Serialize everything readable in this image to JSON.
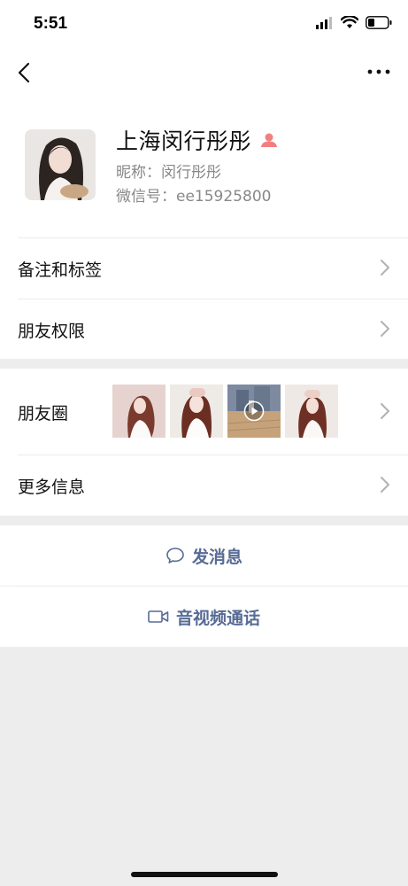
{
  "status_bar": {
    "time": "5:51"
  },
  "profile": {
    "name": "上海闵行彤彤",
    "nickname_line": "昵称：闵行彤彤",
    "wechat_id_line": "微信号：ee15925800"
  },
  "menu": {
    "remarks_tags": "备注和标签",
    "friend_permissions": "朋友权限",
    "moments": "朋友圈",
    "more_info": "更多信息"
  },
  "actions": {
    "send_message": "发消息",
    "video_call": "音视频通话"
  },
  "colors": {
    "link": "#576b95",
    "chevron": "#b2b2b2",
    "person_badge": "#f27f7f",
    "background": "#ededed"
  }
}
